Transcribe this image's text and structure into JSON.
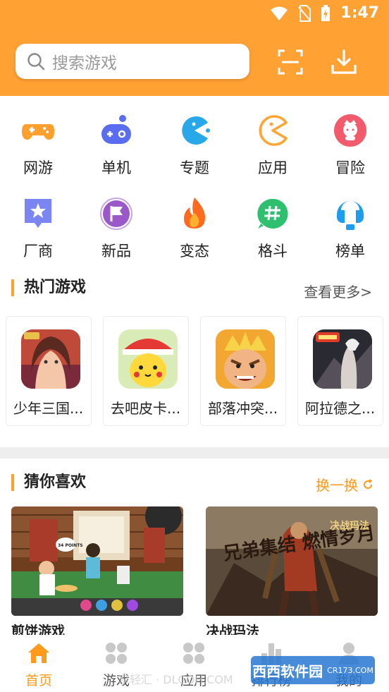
{
  "status": {
    "time": "1:47"
  },
  "search": {
    "placeholder": "搜索游戏"
  },
  "categories": [
    {
      "label": "网游",
      "icon": "gamepad-icon",
      "color": "#ff9f2e"
    },
    {
      "label": "单机",
      "icon": "controller-icon",
      "color": "#5a6cf0"
    },
    {
      "label": "专题",
      "icon": "pacman-icon",
      "color": "#28a8e8"
    },
    {
      "label": "应用",
      "icon": "pacman-outline-icon",
      "color": "#ffa533"
    },
    {
      "label": "冒险",
      "icon": "character-icon",
      "color": "#f25b6b"
    },
    {
      "label": "厂商",
      "icon": "star-card-icon",
      "color": "#7b86f2"
    },
    {
      "label": "新品",
      "icon": "flag-icon",
      "color": "#9b58c8"
    },
    {
      "label": "变态",
      "icon": "flame-icon",
      "color": "#ff6a1f"
    },
    {
      "label": "格斗",
      "icon": "hashtag-chat-icon",
      "color": "#2ec06f"
    },
    {
      "label": "榜单",
      "icon": "headset-icon",
      "color": "#1e9cf0"
    }
  ],
  "hot": {
    "title": "热门游戏",
    "more": "查看更多>",
    "games": [
      {
        "name": "少年三国..."
      },
      {
        "name": "去吧皮卡..."
      },
      {
        "name": "部落冲突..."
      },
      {
        "name": "阿拉德之..."
      }
    ]
  },
  "guess": {
    "title": "猜你喜欢",
    "refresh": "换一换",
    "cards": [
      {
        "name": "煎饼游戏",
        "banner_text": "34 POINTS"
      },
      {
        "name": "决战玛法",
        "banner_text": "兄弟集结 燃情岁月",
        "banner_logo": "决战玛法"
      }
    ]
  },
  "tabs": [
    {
      "label": "首页",
      "icon": "home-icon",
      "active": true
    },
    {
      "label": "游戏",
      "icon": "grid-icon",
      "active": false
    },
    {
      "label": "应用",
      "icon": "apps-icon",
      "active": false
    },
    {
      "label": "排行榜",
      "icon": "ranking-icon",
      "active": false
    },
    {
      "label": "我的",
      "icon": "user-icon",
      "active": false
    }
  ],
  "watermark": {
    "text": "西西软件园",
    "site": "CR173.COM",
    "faint_text": "享轻汇 · DLCOH.COM"
  },
  "colors": {
    "accent": "#ffa133",
    "tab_active": "#ff9a1c"
  }
}
